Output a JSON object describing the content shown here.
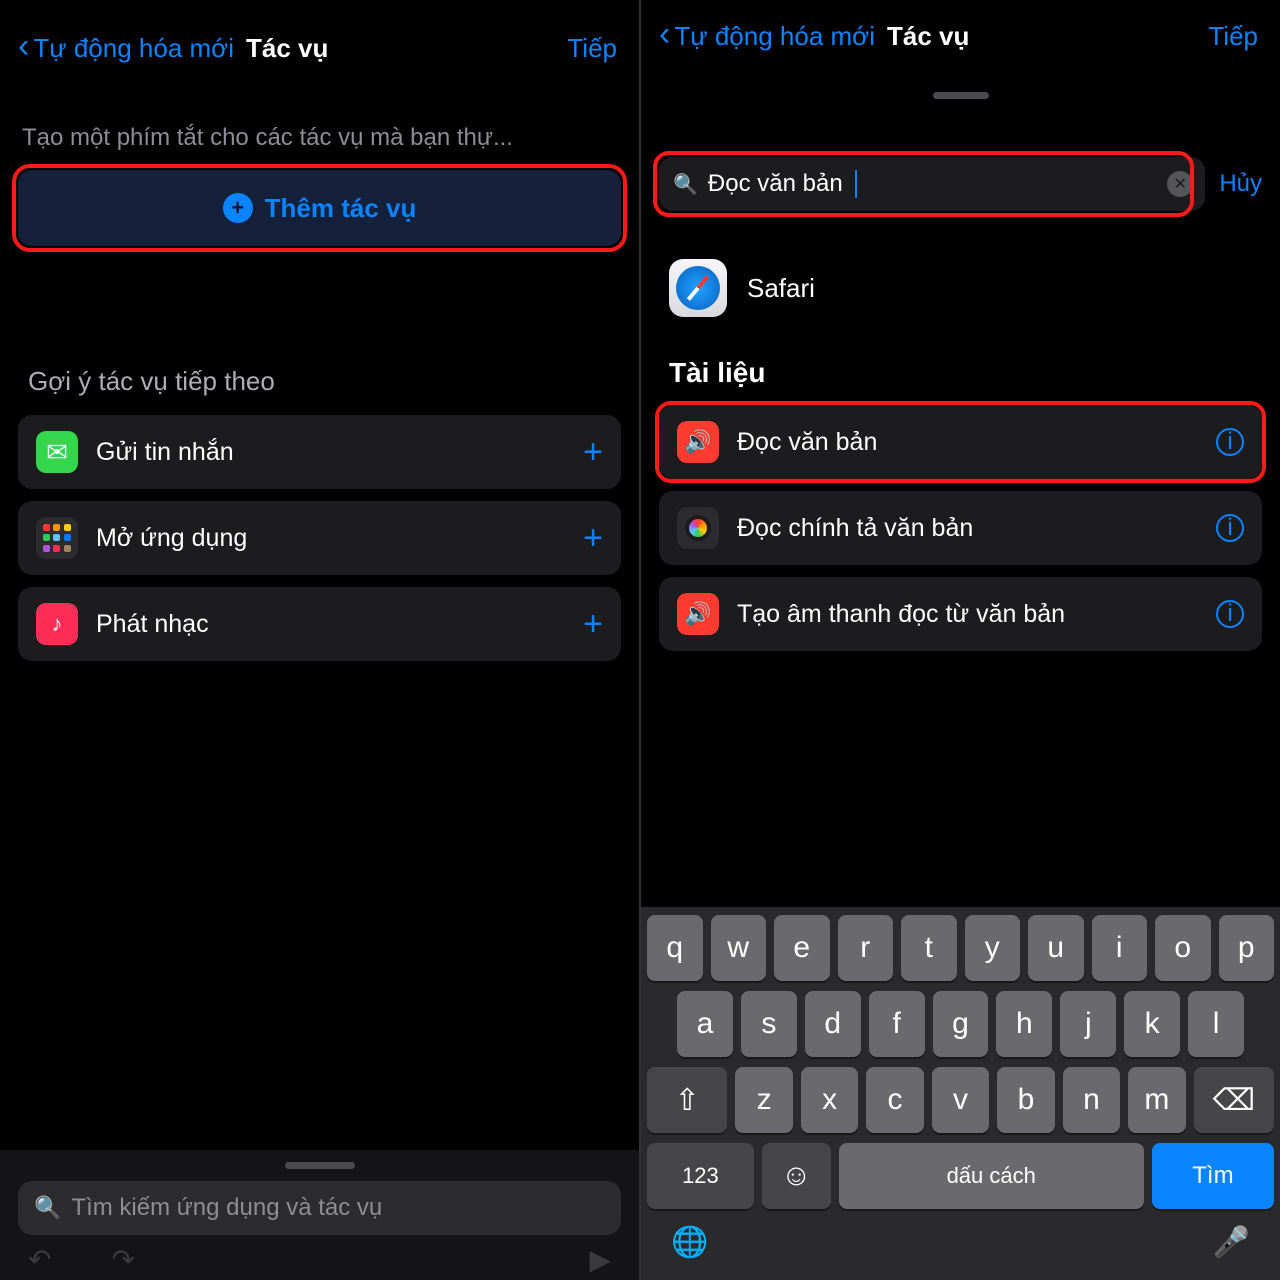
{
  "left": {
    "nav": {
      "back": "Tự động hóa mới",
      "title": "Tác vụ",
      "next": "Tiếp"
    },
    "desc": "Tạo một phím tắt cho các tác vụ mà bạn thự...",
    "add_label": "Thêm tác vụ",
    "suggestions_header": "Gợi ý tác vụ tiếp theo",
    "rows": [
      {
        "label": "Gửi tin nhắn",
        "icon": "messages"
      },
      {
        "label": "Mở ứng dụng",
        "icon": "apps"
      },
      {
        "label": "Phát nhạc",
        "icon": "music"
      }
    ],
    "search_placeholder": "Tìm kiếm ứng dụng và tác vụ"
  },
  "right": {
    "nav": {
      "back": "Tự động hóa mới",
      "title": "Tác vụ",
      "next": "Tiếp"
    },
    "search_value": "Đọc văn bản",
    "cancel": "Hủy",
    "app_result": "Safari",
    "section_header": "Tài liệu",
    "results": [
      {
        "label": "Đọc văn bản",
        "icon": "speak",
        "highlight": true
      },
      {
        "label": "Đọc chính tả văn bản",
        "icon": "circle"
      },
      {
        "label": "Tạo âm thanh đọc từ văn bản",
        "icon": "speak"
      }
    ],
    "keyboard": {
      "row1": [
        "q",
        "w",
        "e",
        "r",
        "t",
        "y",
        "u",
        "i",
        "o",
        "p"
      ],
      "row2": [
        "a",
        "s",
        "d",
        "f",
        "g",
        "h",
        "j",
        "k",
        "l"
      ],
      "row3": [
        "z",
        "x",
        "c",
        "v",
        "b",
        "n",
        "m"
      ],
      "num": "123",
      "space": "dấu cách",
      "search": "Tìm"
    }
  }
}
